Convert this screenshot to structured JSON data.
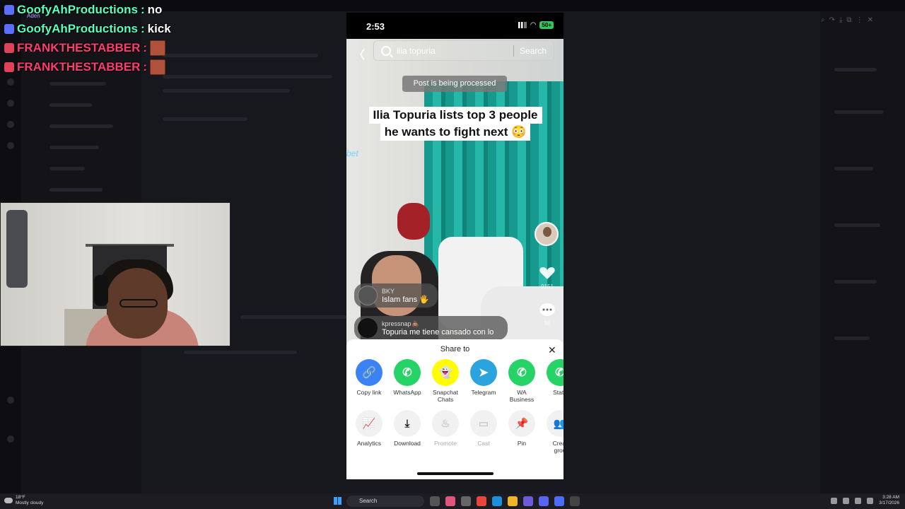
{
  "chat_overlay": {
    "tiny_name": "Aden",
    "lines": [
      {
        "user": "GoofyAhProductions",
        "message": "no"
      },
      {
        "user": "GoofyAhProductions",
        "message": "kick"
      },
      {
        "user": "FRANKTHESTABBER",
        "message": ""
      },
      {
        "user": "FRANKTHESTABBER",
        "message": ""
      }
    ]
  },
  "phone": {
    "status_time": "2:53",
    "battery": "50+",
    "search": {
      "query": "ilia topuria",
      "button": "Search"
    },
    "toast": "Post is being processed",
    "caption": {
      "line1": "Ilia Topuria lists top 3 people",
      "line2": "he wants to fight next 😳"
    },
    "video_neon": "bet",
    "like_count": "9151",
    "comment_count": "96",
    "comments": [
      {
        "user": "BKY",
        "text": "Islam fans 🖐"
      },
      {
        "user": "kpressnap💩",
        "text": "Topuria me tiene cansado con lo"
      }
    ],
    "share": {
      "title": "Share to",
      "row1": [
        {
          "label": "Copy link",
          "icon": "link-icon",
          "color": "#3b82f6"
        },
        {
          "label": "WhatsApp",
          "icon": "whatsapp-icon",
          "color": "#25d366"
        },
        {
          "label": "Snapchat Chats",
          "icon": "snapchat-icon",
          "color": "#fffc00"
        },
        {
          "label": "Telegram",
          "icon": "telegram-icon",
          "color": "#2aa3df"
        },
        {
          "label": "WA Business",
          "icon": "wa-business-icon",
          "color": "#25d366"
        },
        {
          "label": "Statu",
          "icon": "whatsapp-status-icon",
          "color": "#25d366"
        }
      ],
      "row2": [
        {
          "label": "Analytics",
          "icon": "analytics-icon"
        },
        {
          "label": "Download",
          "icon": "download-icon"
        },
        {
          "label": "Promote",
          "icon": "flame-icon"
        },
        {
          "label": "Cast",
          "icon": "cast-icon"
        },
        {
          "label": "Pin",
          "icon": "pin-icon"
        },
        {
          "label": "Creat grou",
          "icon": "group-icon"
        }
      ]
    }
  },
  "taskbar": {
    "weather_temp": "18°F",
    "weather_desc": "Mostly cloudy",
    "search_label": "Search",
    "time": "3:28 AM",
    "date": "3/17/2026"
  }
}
